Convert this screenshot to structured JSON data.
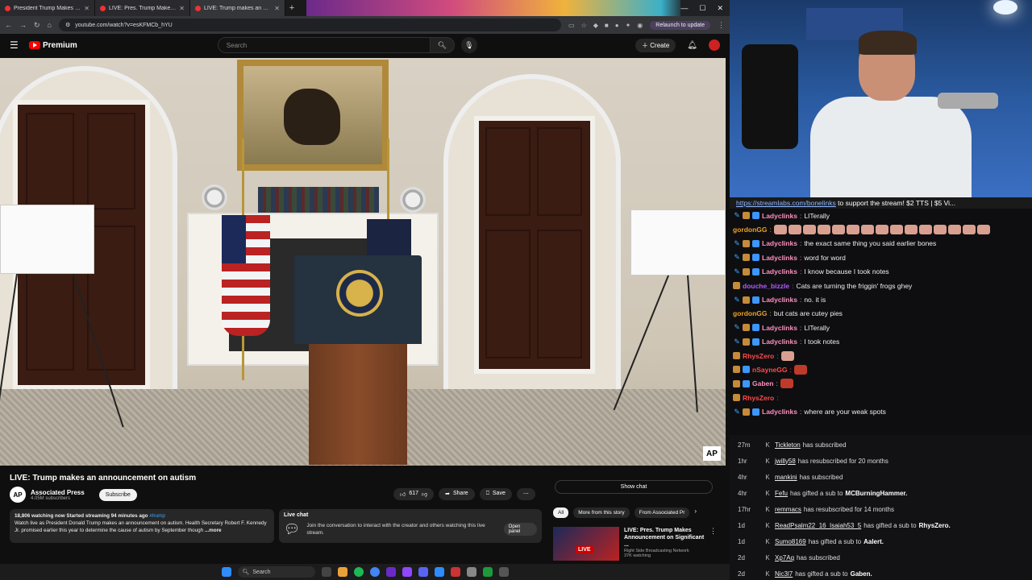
{
  "browser": {
    "tabs": [
      {
        "label": "President Trump Makes an Ann"
      },
      {
        "label": "LIVE: Pres. Trump Makes Anno"
      },
      {
        "label": "LIVE: Trump makes an announ"
      }
    ],
    "url": "youtube.com/watch?v=esKFMCb_hYU",
    "relaunch_label": "Relaunch to update"
  },
  "youtube": {
    "logo_label": "Premium",
    "search_placeholder": "Search",
    "create_label": "Create",
    "video_title": "LIVE: Trump makes an announcement on autism",
    "channel_name": "Associated Press",
    "channel_subs": "4.05M subscribers",
    "subscribe_label": "Subscribe",
    "likes": "617",
    "share_label": "Share",
    "save_label": "Save",
    "show_chat_label": "Show chat",
    "desc_meta": "18,806 watching now  Started streaming 94 minutes ago",
    "desc_tag": "#trump",
    "desc_text": "Watch live as President Donald Trump makes an announcement on autism. Health Secretary Robert F. Kennedy Jr. promised earlier this year to determine the cause of autism by September though",
    "desc_more": "...more",
    "livechat_title": "Live chat",
    "livechat_text": "Join the conversation to interact with the creator and others watching this live stream.",
    "open_panel_label": "Open panel",
    "chips": [
      "All",
      "More from this story",
      "From Associated Pr"
    ],
    "rec": {
      "title": "LIVE: Pres. Trump Makes Announcement on Significant ...",
      "channel": "Right Side Broadcasting Network",
      "watching": "37K watching",
      "live_label": "LIVE"
    },
    "ap_label": "AP"
  },
  "stream": {
    "ticker_link": "https://streamlabs.com/bonelinks",
    "ticker_text": " to support the stream! $2 TTS | $5 Vi..."
  },
  "chat": [
    {
      "user": "Ladyclinks",
      "text": "LITerally",
      "color": "#ff8fbf",
      "badges": [
        "pen",
        "gift",
        "sub"
      ]
    },
    {
      "user": "gordonGG",
      "text": "",
      "color": "#f0a020",
      "badges": [],
      "emotes": 15
    },
    {
      "user": "Ladyclinks",
      "text": "the exact same thing you said earlier bones",
      "color": "#ff8fbf",
      "badges": [
        "pen",
        "gift",
        "sub"
      ]
    },
    {
      "user": "Ladyclinks",
      "text": "word for word",
      "color": "#ff8fbf",
      "badges": [
        "pen",
        "gift",
        "sub"
      ]
    },
    {
      "user": "Ladyclinks",
      "text": "I know because I took notes",
      "color": "#ff8fbf",
      "badges": [
        "pen",
        "gift",
        "sub"
      ]
    },
    {
      "user": "douche_bizzle",
      "text": "Cats are turning the friggin' frogs ghey",
      "color": "#b05cff",
      "badges": [
        "gift"
      ]
    },
    {
      "user": "Ladyclinks",
      "text": "no. it is",
      "color": "#ff8fbf",
      "badges": [
        "pen",
        "gift",
        "sub"
      ]
    },
    {
      "user": "gordonGG",
      "text": "but cats are cutey pies",
      "color": "#f0a020",
      "badges": []
    },
    {
      "user": "Ladyclinks",
      "text": "LITerally",
      "color": "#ff8fbf",
      "badges": [
        "pen",
        "gift",
        "sub"
      ]
    },
    {
      "user": "Ladyclinks",
      "text": "I took notes",
      "color": "#ff8fbf",
      "badges": [
        "pen",
        "gift",
        "sub"
      ]
    },
    {
      "user": "RhysZero",
      "text": "",
      "color": "#ff4a4a",
      "badges": [
        "gift"
      ],
      "emotes": 1
    },
    {
      "user": "nSayneGG",
      "text": "",
      "color": "#ff4a4a",
      "badges": [
        "gift",
        "sub"
      ],
      "emotes": 1,
      "emote_red": true
    },
    {
      "user": "Gaben",
      "text": "",
      "color": "#ff8fbf",
      "badges": [
        "gift",
        "sub"
      ],
      "emotes": 1,
      "emote_red": true
    },
    {
      "user": "RhysZero",
      "text": "",
      "color": "#ff4a4a",
      "badges": [
        "gift"
      ]
    },
    {
      "user": "Ladyclinks",
      "text": "where are your weak spots",
      "color": "#ff8fbf",
      "badges": [
        "pen",
        "gift",
        "sub"
      ]
    }
  ],
  "events": [
    {
      "time": "27m",
      "user": "Tickleton",
      "text": "has subscribed",
      "extra": ""
    },
    {
      "time": "1hr",
      "user": "jwilly58",
      "text": "has resubscribed for 20 months",
      "extra": ""
    },
    {
      "time": "4hr",
      "user": "mankini",
      "text": "has subscribed",
      "extra": ""
    },
    {
      "time": "4hr",
      "user": "Fefu",
      "text": "has gifted a sub to",
      "extra": "MCBurningHammer."
    },
    {
      "time": "17hr",
      "user": "remmacs",
      "text": "has resubscribed for 14 months",
      "extra": ""
    },
    {
      "time": "1d",
      "user": "ReadPsalm22_16_Isaiah53_5",
      "text": "has gifted a sub to",
      "extra": "RhysZero."
    },
    {
      "time": "1d",
      "user": "Sumo8169",
      "text": "has gifted a sub to",
      "extra": "Aalert."
    },
    {
      "time": "2d",
      "user": "Xp7Aq",
      "text": "has subscribed",
      "extra": ""
    },
    {
      "time": "2d",
      "user": "Nic3l7",
      "text": "has gifted a sub to",
      "extra": "Gaben."
    }
  ],
  "taskbar": {
    "search_label": "Search"
  }
}
